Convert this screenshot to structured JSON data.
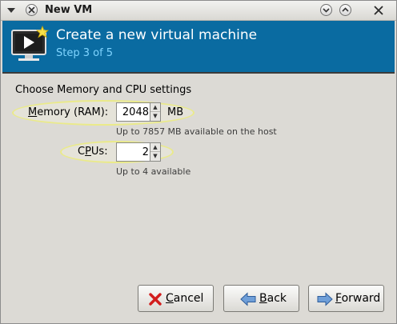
{
  "window": {
    "title": "New VM"
  },
  "banner": {
    "title": "Create a new virtual machine",
    "step": "Step 3 of 5"
  },
  "section": {
    "heading": "Choose Memory and CPU settings"
  },
  "memory": {
    "label_prefix": "M",
    "label_rest": "emory (RAM):",
    "value": "2048",
    "unit": "MB",
    "hint": "Up to 7857 MB available on the host"
  },
  "cpus": {
    "label_prefix": "C",
    "label_mnemonic": "P",
    "label_rest": "Us:",
    "value": "2",
    "hint": "Up to 4 available"
  },
  "buttons": {
    "cancel": {
      "mnemonic": "C",
      "rest": "ancel"
    },
    "back": {
      "mnemonic": "B",
      "rest": "ack"
    },
    "forward": {
      "mnemonic": "F",
      "rest": "orward"
    }
  },
  "colors": {
    "banner_bg": "#0a6ba1",
    "banner_title": "#ffffff",
    "banner_step": "#7fd4ff",
    "highlight": "#eaea8a",
    "dialog_bg": "#dcdad5"
  },
  "icons": {
    "window_menu": "down-triangle-icon",
    "close": "x-circle-icon",
    "minimize": "chevron-down-circle-icon",
    "maximize": "chevron-up-circle-icon",
    "banner": "vm-monitor-play-icon",
    "cancel": "red-x-icon",
    "back": "blue-left-arrow-icon",
    "forward": "blue-right-arrow-icon"
  }
}
